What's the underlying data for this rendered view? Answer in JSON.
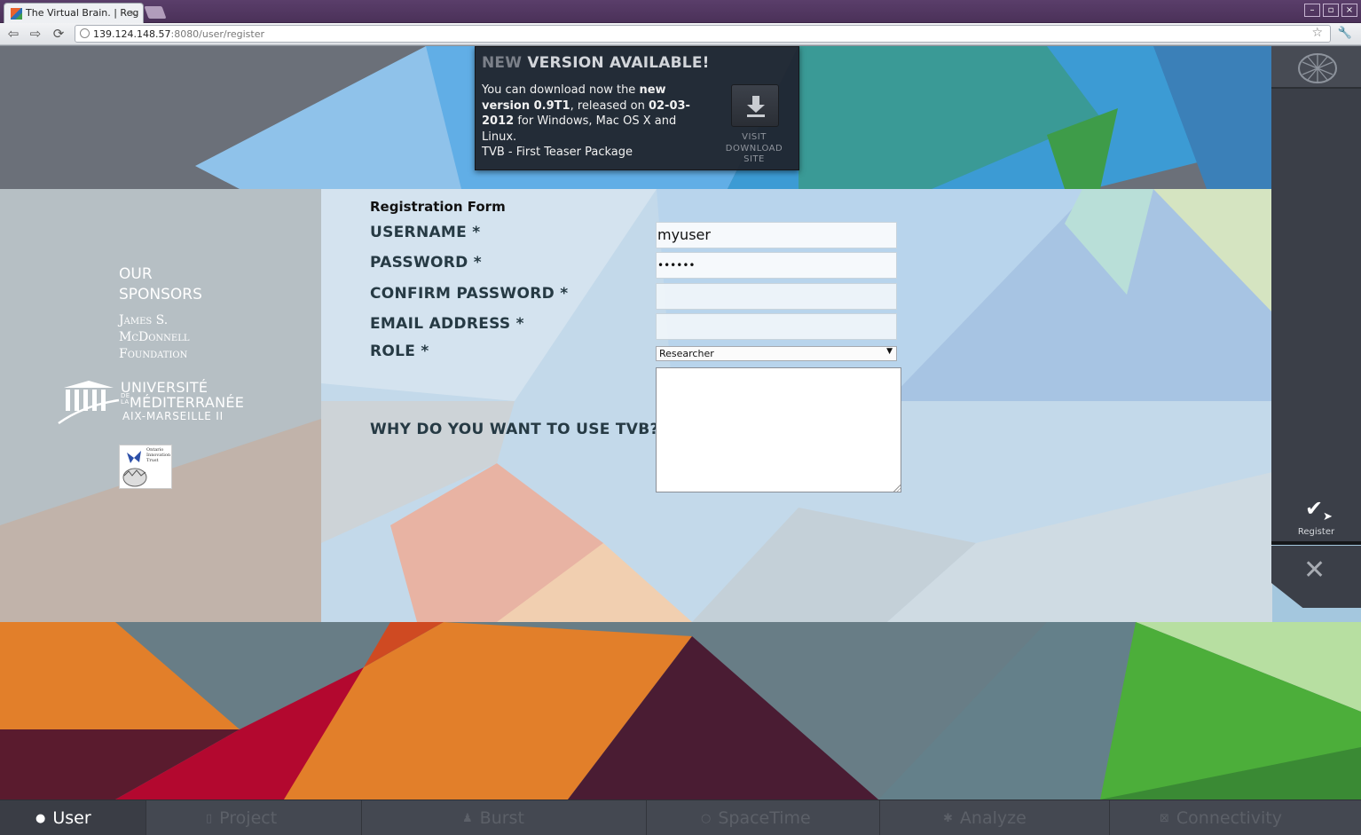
{
  "browser": {
    "tab_title": "The Virtual Brain. | Reg",
    "tab_close": "×",
    "url_host": "139.124.148.57",
    "url_rest": ":8080/user/register",
    "window_buttons": [
      "–",
      "▫",
      "×"
    ]
  },
  "notice": {
    "title_dim": "NEW",
    "title": "VERSION AVAILABLE!",
    "line1a": "You can download now the ",
    "line1b": "new version 0.9T1",
    "line1c": ", released on ",
    "line1d": "02-03-2012",
    "line1e": " for Windows, Mac OS X and Linux.",
    "line2": "TVB - First Teaser Package",
    "download_label_1": "VISIT",
    "download_label_2": "DOWNLOAD",
    "download_label_3": "SITE"
  },
  "sponsors": {
    "title_1": "OUR",
    "title_2": "SPONSORS",
    "mcdonnell_1": "James S.",
    "mcdonnell_2": "McDonnell",
    "mcdonnell_3": "Foundation",
    "univ_1": "UNIVERSITÉ",
    "univ_de": "DE",
    "univ_la": "LA",
    "univ_2": "MÉDITERRANÉE",
    "univ_3": "AIX-MARSEILLE II",
    "oit_1": "Ontario",
    "oit_2": "Innovation",
    "oit_3": "Trust"
  },
  "form": {
    "title": "Registration Form",
    "username_label": "USERNAME *",
    "username_value": "myuser",
    "password_label": "PASSWORD *",
    "password_value": "••••••",
    "confirm_label": "CONFIRM PASSWORD *",
    "confirm_value": "",
    "email_label": "EMAIL ADDRESS *",
    "email_value": "",
    "role_label": "ROLE *",
    "role_value": "Researcher",
    "why_label": "WHY DO YOU WANT TO USE TVB?",
    "why_value": ""
  },
  "sidebar": {
    "register_label": "Register",
    "cancel_icon": "close-icon"
  },
  "bottom_nav": [
    "User",
    "Project",
    "Burst",
    "SpaceTime",
    "Analyze",
    "Connectivity"
  ],
  "colors": {
    "accent_orange": "#e27f2a",
    "accent_green": "#4cae3a",
    "dark_panel": "#3b3f48"
  }
}
